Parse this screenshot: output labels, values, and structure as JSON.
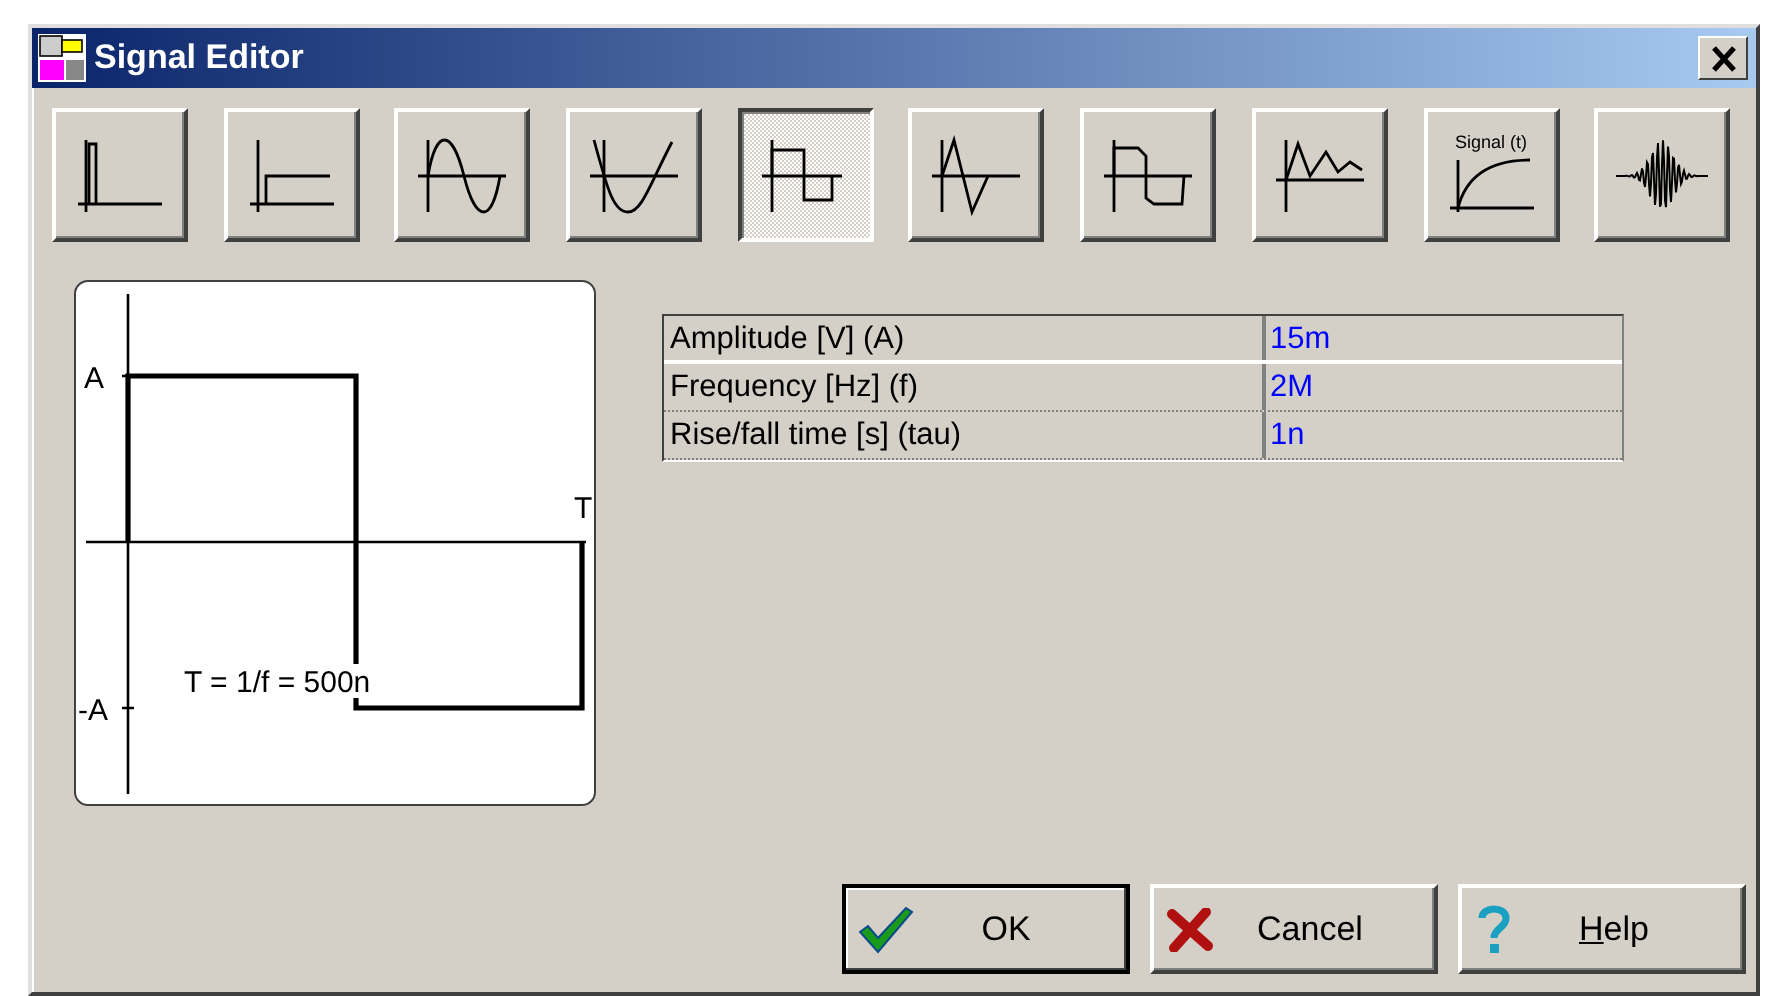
{
  "window": {
    "title": "Signal Editor"
  },
  "signal_types": [
    {
      "kind": "pulse",
      "selected": false
    },
    {
      "kind": "step",
      "selected": false
    },
    {
      "kind": "sine",
      "selected": false
    },
    {
      "kind": "cosine",
      "selected": false
    },
    {
      "kind": "square",
      "selected": true
    },
    {
      "kind": "triangle",
      "selected": false
    },
    {
      "kind": "trapezoid",
      "selected": false
    },
    {
      "kind": "damped",
      "selected": false
    },
    {
      "kind": "response",
      "label": "Signal (t)",
      "selected": false
    },
    {
      "kind": "burst",
      "selected": false
    }
  ],
  "waveform_preview": {
    "amplitude_label": "A",
    "negative_amplitude_label": "-A",
    "period_marker": "T",
    "period_formula": "T = 1/f = 500n"
  },
  "parameters": [
    {
      "name": "Amplitude [V] (A)",
      "value": "15m"
    },
    {
      "name": "Frequency [Hz] (f)",
      "value": "2M"
    },
    {
      "name": "Rise/fall time [s] (tau)",
      "value": "1n"
    }
  ],
  "buttons": [
    {
      "kind": "ok",
      "label": "OK",
      "default": true
    },
    {
      "kind": "cancel",
      "label": "Cancel",
      "default": false
    },
    {
      "kind": "help",
      "label": "Help",
      "default": false,
      "mnemonic_underlined": true
    }
  ]
}
